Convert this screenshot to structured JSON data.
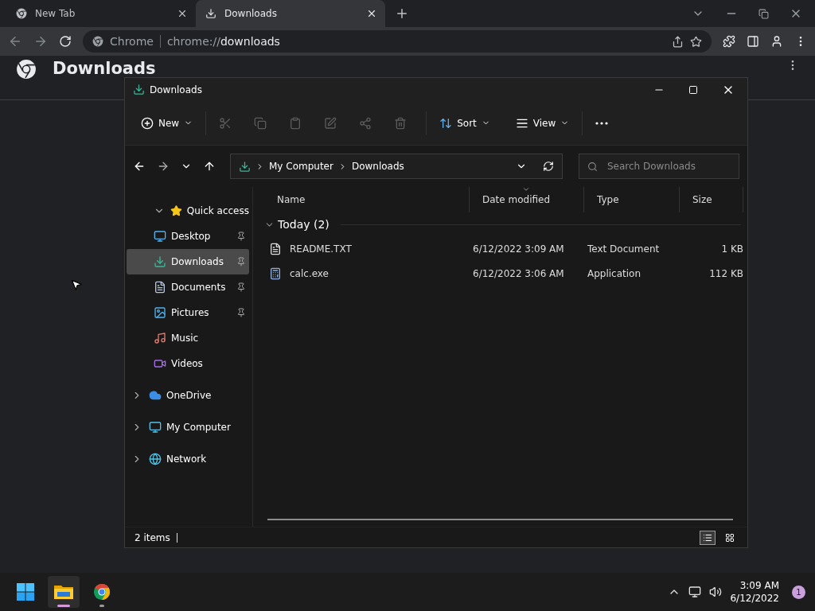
{
  "browser": {
    "tabs": [
      {
        "label": "New Tab",
        "selected": false
      },
      {
        "label": "Downloads",
        "selected": true
      }
    ],
    "address": {
      "site": "Chrome",
      "url_prefix": "chrome://",
      "url_host": "downloads"
    },
    "page": {
      "title": "Downloads"
    }
  },
  "explorer": {
    "title": "Downloads",
    "toolbar": {
      "new": {
        "label": "New"
      },
      "actions": [
        {
          "disabled": true
        },
        {
          "disabled": true
        },
        {
          "disabled": true
        },
        {
          "disabled": true
        },
        {
          "disabled": true
        },
        {
          "disabled": true
        }
      ],
      "sort": {
        "label": "Sort"
      },
      "view": {
        "label": "View"
      }
    },
    "breadcrumb": [
      "My Computer",
      "Downloads"
    ],
    "search": {
      "placeholder": "Search Downloads"
    },
    "nav": [
      {
        "label": "Quick access",
        "expanded": true,
        "selected": false,
        "children": [
          {
            "label": "Desktop",
            "pinned": true,
            "selected": false
          },
          {
            "label": "Downloads",
            "pinned": true,
            "selected": true
          },
          {
            "label": "Documents",
            "pinned": true,
            "selected": false
          },
          {
            "label": "Pictures",
            "pinned": true,
            "selected": false
          },
          {
            "label": "Music",
            "pinned": false,
            "selected": false
          },
          {
            "label": "Videos",
            "pinned": false,
            "selected": false
          }
        ]
      },
      {
        "label": "OneDrive",
        "expanded": false,
        "selected": false
      },
      {
        "label": "My Computer",
        "expanded": false,
        "selected": false
      },
      {
        "label": "Network",
        "expanded": false,
        "selected": false
      }
    ],
    "columns": [
      {
        "label": "Name",
        "sorted": false
      },
      {
        "label": "Date modified",
        "sorted": true
      },
      {
        "label": "Type",
        "sorted": false
      },
      {
        "label": "Size",
        "sorted": false
      }
    ],
    "groups": [
      {
        "label": "Today (2)",
        "expanded": true,
        "rows": [
          {
            "name": "README.TXT",
            "date": "6/12/2022 3:09 AM",
            "type": "Text Document",
            "size": "1 KB",
            "selected": false
          },
          {
            "name": "calc.exe",
            "date": "6/12/2022 3:06 AM",
            "type": "Application",
            "size": "112 KB",
            "selected": false
          }
        ]
      }
    ],
    "status": "2 items",
    "views": [
      {
        "selected": true
      },
      {
        "selected": false
      }
    ]
  },
  "taskbar": {
    "apps": [
      {
        "selected": false,
        "running": false
      },
      {
        "selected": true,
        "running": true
      },
      {
        "selected": false,
        "running": true
      }
    ],
    "time": "3:09 AM",
    "date": "6/12/2022",
    "notifications": "1"
  }
}
